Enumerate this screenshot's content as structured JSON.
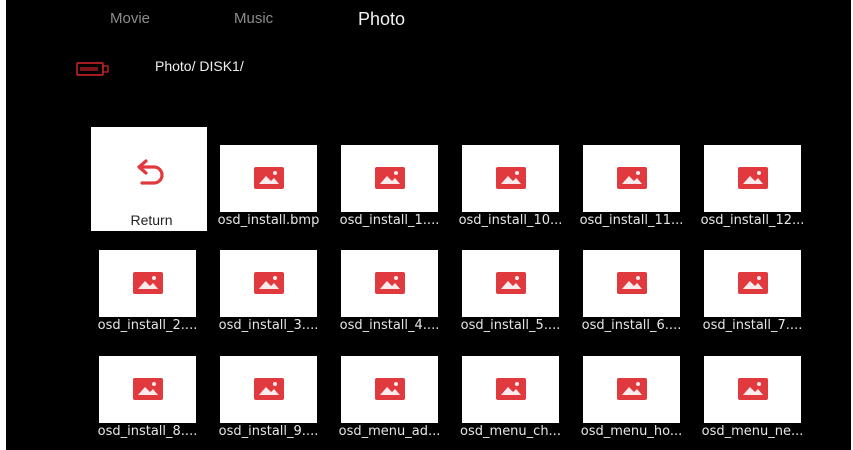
{
  "tabs": [
    {
      "label": "Movie"
    },
    {
      "label": "Music"
    },
    {
      "label": "Photo"
    }
  ],
  "path": {
    "icon": "usb-drive-icon",
    "text": "Photo/ DISK1/"
  },
  "return_tile": {
    "label": "Return",
    "icon": "return-arrow-icon"
  },
  "items": [
    {
      "label": "osd_install.bmp"
    },
    {
      "label": "osd_install_1...."
    },
    {
      "label": "osd_install_10..."
    },
    {
      "label": "osd_install_11..."
    },
    {
      "label": "osd_install_12..."
    },
    {
      "label": "osd_install_2...."
    },
    {
      "label": "osd_install_3...."
    },
    {
      "label": "osd_install_4...."
    },
    {
      "label": "osd_install_5...."
    },
    {
      "label": "osd_install_6...."
    },
    {
      "label": "osd_install_7...."
    },
    {
      "label": "osd_install_8...."
    },
    {
      "label": "osd_install_9...."
    },
    {
      "label": "osd_menu_ad..."
    },
    {
      "label": "osd_menu_ch..."
    },
    {
      "label": "osd_menu_ho..."
    },
    {
      "label": "osd_menu_ne..."
    }
  ],
  "colors": {
    "background": "#000000",
    "accent_red": "#e0393e",
    "tile": "#ffffff"
  }
}
